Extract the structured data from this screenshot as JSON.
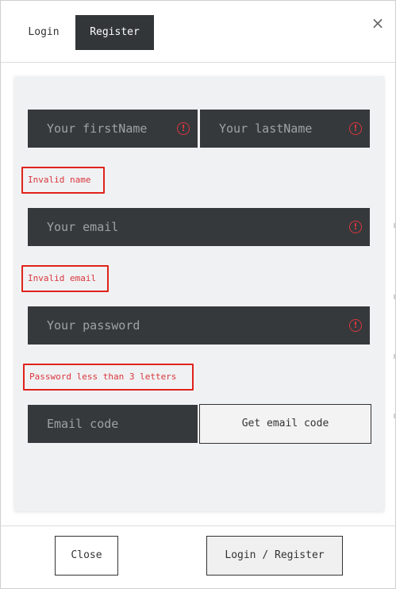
{
  "tabs": {
    "login_label": "Login",
    "register_label": "Register",
    "active": "Register"
  },
  "close_glyph": "×",
  "form": {
    "first_name": {
      "placeholder": "Your firstName",
      "value": ""
    },
    "last_name": {
      "placeholder": "Your lastName",
      "value": ""
    },
    "email": {
      "placeholder": "Your email",
      "value": ""
    },
    "password": {
      "placeholder": "Your password",
      "value": ""
    },
    "email_code": {
      "placeholder": "Email code",
      "value": ""
    },
    "get_code_label": "Get email code"
  },
  "errors": {
    "name": "Invalid name",
    "email": "Invalid email",
    "password": "Password less than 3 letters"
  },
  "icons": {
    "warning": "warning-icon",
    "warning_glyph": "!",
    "warning_color": "#d9363e"
  },
  "footer": {
    "close_label": "Close",
    "submit_label": "Login / Register"
  },
  "colors": {
    "field_bg": "#36393c",
    "active_tab_bg": "#323639",
    "error": "#e0231c",
    "panel_bg": "#f0f1f2"
  }
}
